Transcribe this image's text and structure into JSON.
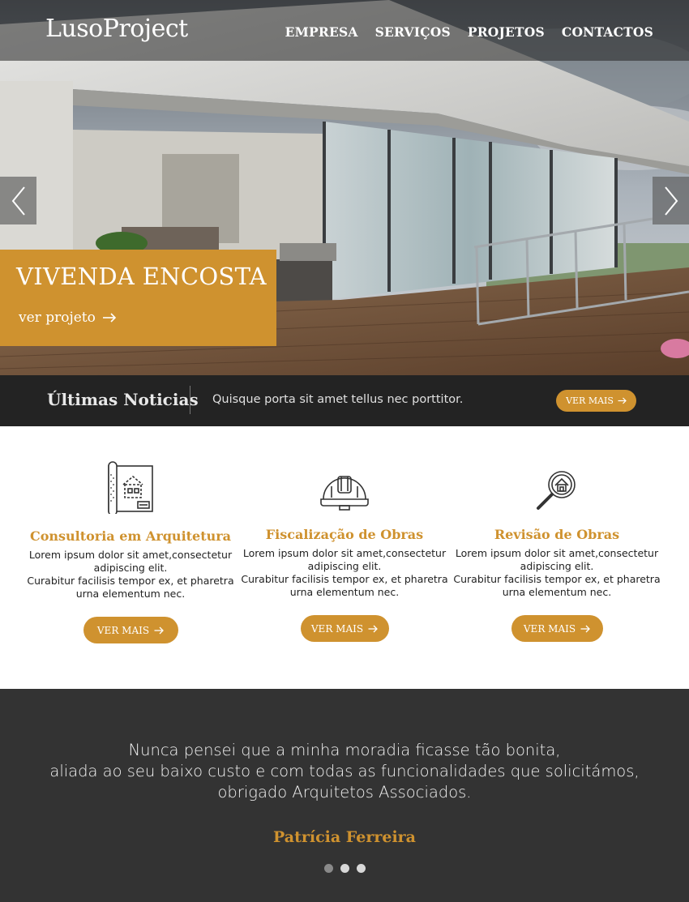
{
  "header": {
    "logo": "LusoProject",
    "nav": [
      "EMPRESA",
      "SERVIÇOS",
      "PROJETOS",
      "CONTACTOS"
    ]
  },
  "hero": {
    "title": "VIVENDA ENCOSTA",
    "link_label": "ver projeto"
  },
  "news": {
    "title": "Últimas Noticias",
    "text": "Quisque porta sit amet tellus nec porttitor.",
    "button": "VER MAIS"
  },
  "services": [
    {
      "icon": "blueprint-icon",
      "title": "Consultoria em Arquitetura",
      "desc_lines": [
        "Lorem ipsum dolor sit amet,consectetur",
        "adipiscing elit.",
        "Curabitur facilisis tempor ex, et pharetra",
        "urna elementum nec."
      ],
      "button": "VER MAIS"
    },
    {
      "icon": "hard-hat-icon",
      "title": "Fiscalização de Obras",
      "desc_lines": [
        "Lorem ipsum dolor sit amet,consectetur",
        "adipiscing elit.",
        "Curabitur facilisis tempor ex, et pharetra",
        "urna elementum nec."
      ],
      "button": "VER MAIS"
    },
    {
      "icon": "house-search-icon",
      "title": "Revisão de Obras",
      "desc_lines": [
        "Lorem ipsum dolor sit amet,consectetur",
        "adipiscing elit.",
        "Curabitur facilisis tempor ex, et pharetra",
        "urna elementum nec."
      ],
      "button": "VER MAIS"
    }
  ],
  "testimonial": {
    "quote_lines": [
      "Nunca pensei que a minha moradia ficasse tão bonita,",
      "aliada ao seu baixo custo e com todas as funcionalidades que solicitámos,",
      "obrigado Arquitetos Associados."
    ],
    "author": "Patrícia Ferreira",
    "dots_count": 3,
    "active_dot": 1
  },
  "colors": {
    "accent": "#cf922f",
    "newsbar_bg": "#232323",
    "testimonial_bg": "#333333"
  }
}
